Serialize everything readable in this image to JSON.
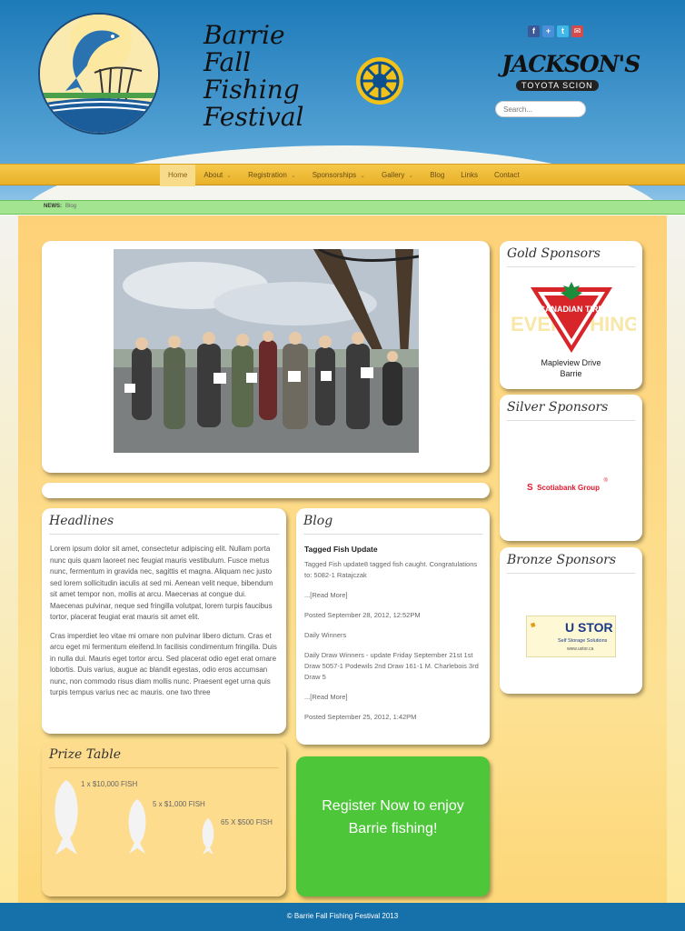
{
  "site": {
    "title_lines": [
      "Barrie",
      "Fall",
      "Fishing",
      "Festival"
    ],
    "search_placeholder": "Search..."
  },
  "header_sponsor": {
    "name": "JACKSON'S",
    "sub": "TOYOTA SCION"
  },
  "social": [
    "facebook-icon",
    "plus-icon",
    "twitter-icon",
    "email-icon"
  ],
  "nav": {
    "items": [
      {
        "label": "Home",
        "active": true,
        "dropdown": false
      },
      {
        "label": "About",
        "dropdown": true
      },
      {
        "label": "Registration",
        "dropdown": true
      },
      {
        "label": "Sponsorships",
        "dropdown": true
      },
      {
        "label": "Gallery",
        "dropdown": true
      },
      {
        "label": "Blog",
        "dropdown": false
      },
      {
        "label": "Links",
        "dropdown": false
      },
      {
        "label": "Contact",
        "dropdown": false
      }
    ]
  },
  "news": {
    "label": "NEWS:",
    "value": "Blog"
  },
  "headlines": {
    "title": "Headlines",
    "p1": "Lorem ipsum dolor sit amet, consectetur adipiscing elit. Nullam porta nunc quis quam laoreet nec feugiat mauris vestibulum. Fusce metus nunc, fermentum in gravida nec, sagittis et magna. Aliquam nec justo sed lorem sollicitudin iaculis at sed mi. Aenean velit neque, bibendum sit amet tempor non, mollis at arcu. Maecenas at congue dui. Maecenas pulvinar, neque sed fringilla volutpat, lorem turpis faucibus tortor, placerat feugiat erat mauris sit amet elit.",
    "p2": "Cras imperdiet leo vitae mi ornare non pulvinar libero dictum. Cras et arcu eget mi fermentum eleifend.In facilisis condimentum fringilla. Duis in nulla dui. Mauris eget tortor arcu. Sed placerat odio eget erat ornare lobortis. Duis varius, augue ac blandit egestas, odio eros accumsan nunc, non commodo risus diam mollis nunc. Praesent eget urna quis turpis tempus varius nec ac mauris. one two three"
  },
  "blog": {
    "title": "Blog",
    "post_title": "Tagged Fish Update",
    "post1_body": "Tagged Fish update8 tagged fish caught. Congratulations to: 5082-1 Ratajczak",
    "read_more": "...[Read More]",
    "post1_date": "Posted September 28, 2012, 12:52PM",
    "post2_title": "Daily Winners",
    "post2_body": "Daily Draw Winners - update Friday September 21st 1st Draw 5057-1 Podewils 2nd Draw 161-1 M. Charlebois 3rd Draw 5",
    "post2_date": "Posted September 25, 2012, 1:42PM"
  },
  "prize": {
    "title": "Prize Table",
    "labels": [
      "1 x $10,000 FISH",
      "5 x $1,000 FISH",
      "65 X $500 FISH"
    ]
  },
  "register": {
    "cta": "Register Now to enjoy Barrie fishing!"
  },
  "sponsors": {
    "gold_title": "Gold Sponsors",
    "gold_name": "CANADIAN TIRE",
    "gold_location_1": "Mapleview Drive",
    "gold_location_2": "Barrie",
    "silver_title": "Silver Sponsors",
    "silver_name": "Scotiabank Group",
    "bronze_title": "Bronze Sponsors",
    "bronze_name": "U STOR",
    "bronze_sub": "Self Storage Solutions",
    "bronze_url": "www.ustor.ca"
  },
  "footer": {
    "text": "© Barrie Fall Fishing Festival 2013"
  },
  "colors": {
    "header_blue": "#1d7ab8",
    "nav_gold": "#f5c84a",
    "news_green": "#a3e490",
    "register_green": "#4ec63a",
    "footer_blue": "#1670aa"
  }
}
